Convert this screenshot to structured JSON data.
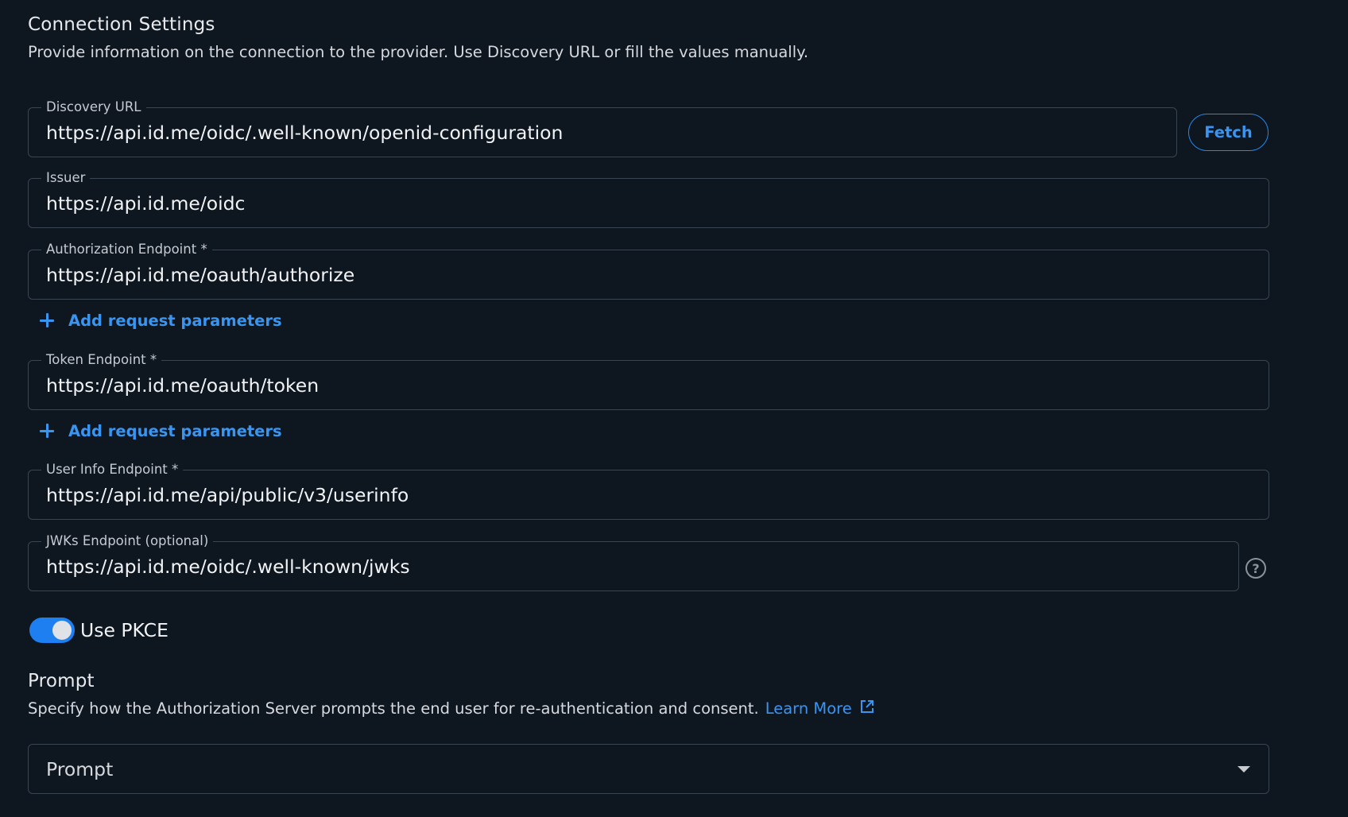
{
  "connection": {
    "title": "Connection Settings",
    "description": "Provide information on the connection to the provider. Use Discovery URL or fill the values manually."
  },
  "fields": {
    "discovery_url": {
      "label": "Discovery URL",
      "value": "https://api.id.me/oidc/.well-known/openid-configuration"
    },
    "issuer": {
      "label": "Issuer",
      "value": "https://api.id.me/oidc"
    },
    "authorization_endpoint": {
      "label": "Authorization Endpoint *",
      "value": "https://api.id.me/oauth/authorize"
    },
    "token_endpoint": {
      "label": "Token Endpoint *",
      "value": "https://api.id.me/oauth/token"
    },
    "user_info_endpoint": {
      "label": "User Info Endpoint *",
      "value": "https://api.id.me/api/public/v3/userinfo"
    },
    "jwks_endpoint": {
      "label": "JWKs Endpoint (optional)",
      "value": "https://api.id.me/oidc/.well-known/jwks"
    }
  },
  "actions": {
    "fetch_label": "Fetch",
    "add_request_parameters_label": "Add request parameters"
  },
  "pkce": {
    "label": "Use PKCE",
    "enabled": true
  },
  "prompt": {
    "title": "Prompt",
    "description": "Specify how the Authorization Server prompts the end user for re-authentication and consent.",
    "learn_more_label": "Learn More",
    "select_placeholder": "Prompt"
  },
  "icons": {
    "add": "plus-icon",
    "help": "help-circle-icon",
    "external": "external-link-icon",
    "dropdown": "caret-down-icon"
  },
  "colors": {
    "background": "#0e1620",
    "accent": "#3a95f0",
    "border": "#3a4553",
    "toggle_on": "#1e7ff0"
  }
}
